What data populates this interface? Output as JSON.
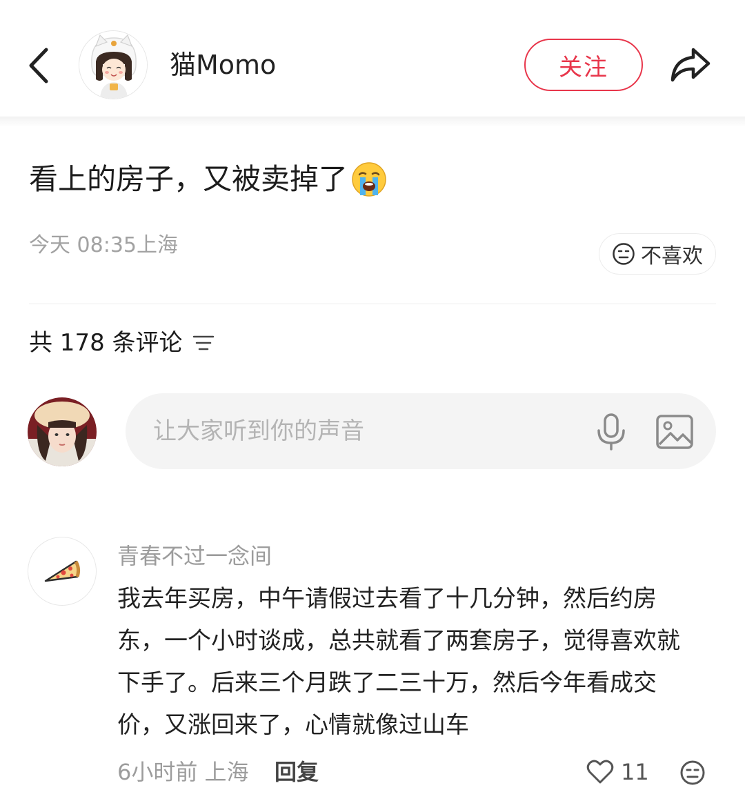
{
  "header": {
    "author_name": "猫Momo",
    "follow_label": "关注"
  },
  "post": {
    "title": "看上的房子，又被卖掉了",
    "meta": "今天 08:35上海",
    "dislike_label": "不喜欢"
  },
  "comments_section": {
    "count_label": "共 178 条评论",
    "input_placeholder": "让大家听到你的声音"
  },
  "comments": [
    {
      "username": "青春不过一念间",
      "text": "我去年买房，中午请假过去看了十几分钟，然后约房东，一个小时谈成，总共就看了两套房子，觉得喜欢就下手了。后来三个月跌了二三十万，然后今年看成交价，又涨回来了，心情就像过山车",
      "time_location": "6小时前 上海",
      "reply_label": "回复",
      "like_count": "11"
    }
  ],
  "icons": {
    "back": "chevron-left-icon",
    "share": "share-arrow-icon",
    "title_emoji": "loudly-crying-face-emoji",
    "dislike": "neutral-face-icon",
    "sort": "sort-lines-icon",
    "mic": "microphone-icon",
    "image": "image-icon",
    "like": "heart-outline-icon"
  },
  "colors": {
    "accent": "#e8364b",
    "muted_text": "#9c9c9c",
    "input_bg": "#f4f4f4"
  }
}
